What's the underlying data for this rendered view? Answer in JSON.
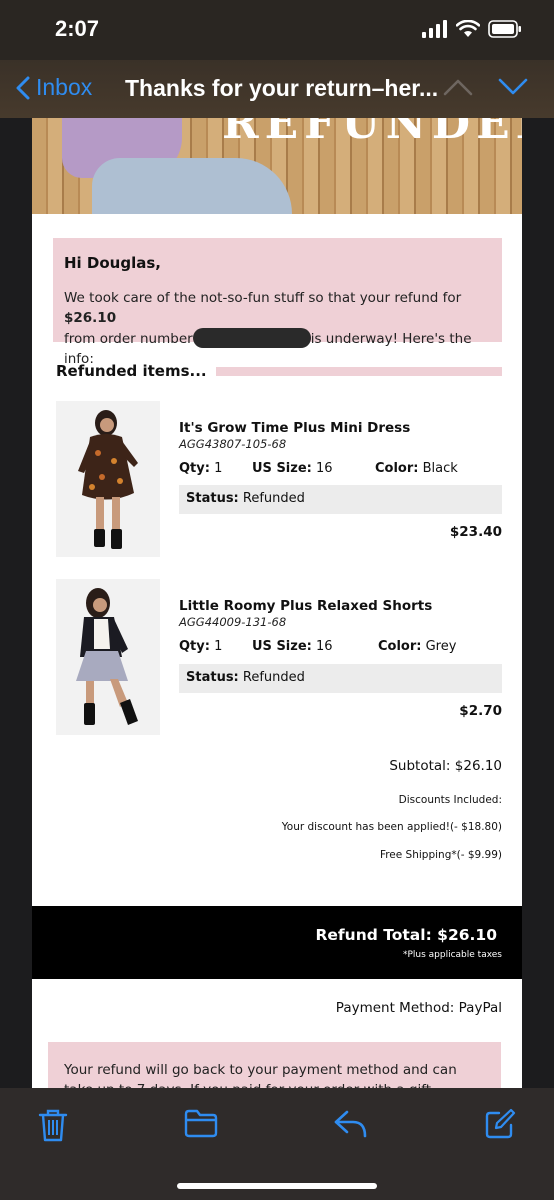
{
  "status_bar": {
    "time": "2:07"
  },
  "nav": {
    "back_label": "Inbox",
    "title": "Thanks for your return–her..."
  },
  "hero": {
    "text": "REFUNDED."
  },
  "greeting": {
    "name": "Hi Douglas,",
    "text_before_amount": "We took care of the not-so-fun stuff so that your refund for ",
    "amount": "$26.10",
    "text_after_amount": " from order number",
    "text_after_order": "is underway! Here's the info:"
  },
  "refunded_heading": "Refunded items...",
  "items": [
    {
      "name": "It's Grow Time Plus Mini Dress",
      "sku": "AGG43807-105-68",
      "qty_label": "Qty:",
      "qty": "1",
      "size_label": "US Size:",
      "size": "16",
      "color_label": "Color:",
      "color": "Black",
      "status_label": "Status:",
      "status": "Refunded",
      "price": "$23.40"
    },
    {
      "name": "Little Roomy Plus Relaxed Shorts",
      "sku": "AGG44009-131-68",
      "qty_label": "Qty:",
      "qty": "1",
      "size_label": "US Size:",
      "size": "16",
      "color_label": "Color:",
      "color": "Grey",
      "status_label": "Status:",
      "status": "Refunded",
      "price": "$2.70"
    }
  ],
  "summary": {
    "subtotal": "Subtotal: $26.10",
    "discounts_label": "Discounts Included:",
    "discount_applied": "Your discount has been applied!(- $18.80)",
    "free_shipping": "Free Shipping*(- $9.99)"
  },
  "total": {
    "text": "Refund Total: $26.10",
    "note": "*Plus applicable taxes"
  },
  "payment_method": "Payment Method: PayPal",
  "refund_note": "Your refund will go back to your payment method and can take up to 7 days. If you paid for your order with a gift voucher, a new",
  "colors": {
    "accent": "#2f8cf0",
    "pink": "#efd0d6",
    "black_bar": "#000000"
  },
  "toolbar": {
    "icons": [
      "trash-icon",
      "folder-icon",
      "reply-icon",
      "compose-icon"
    ]
  }
}
